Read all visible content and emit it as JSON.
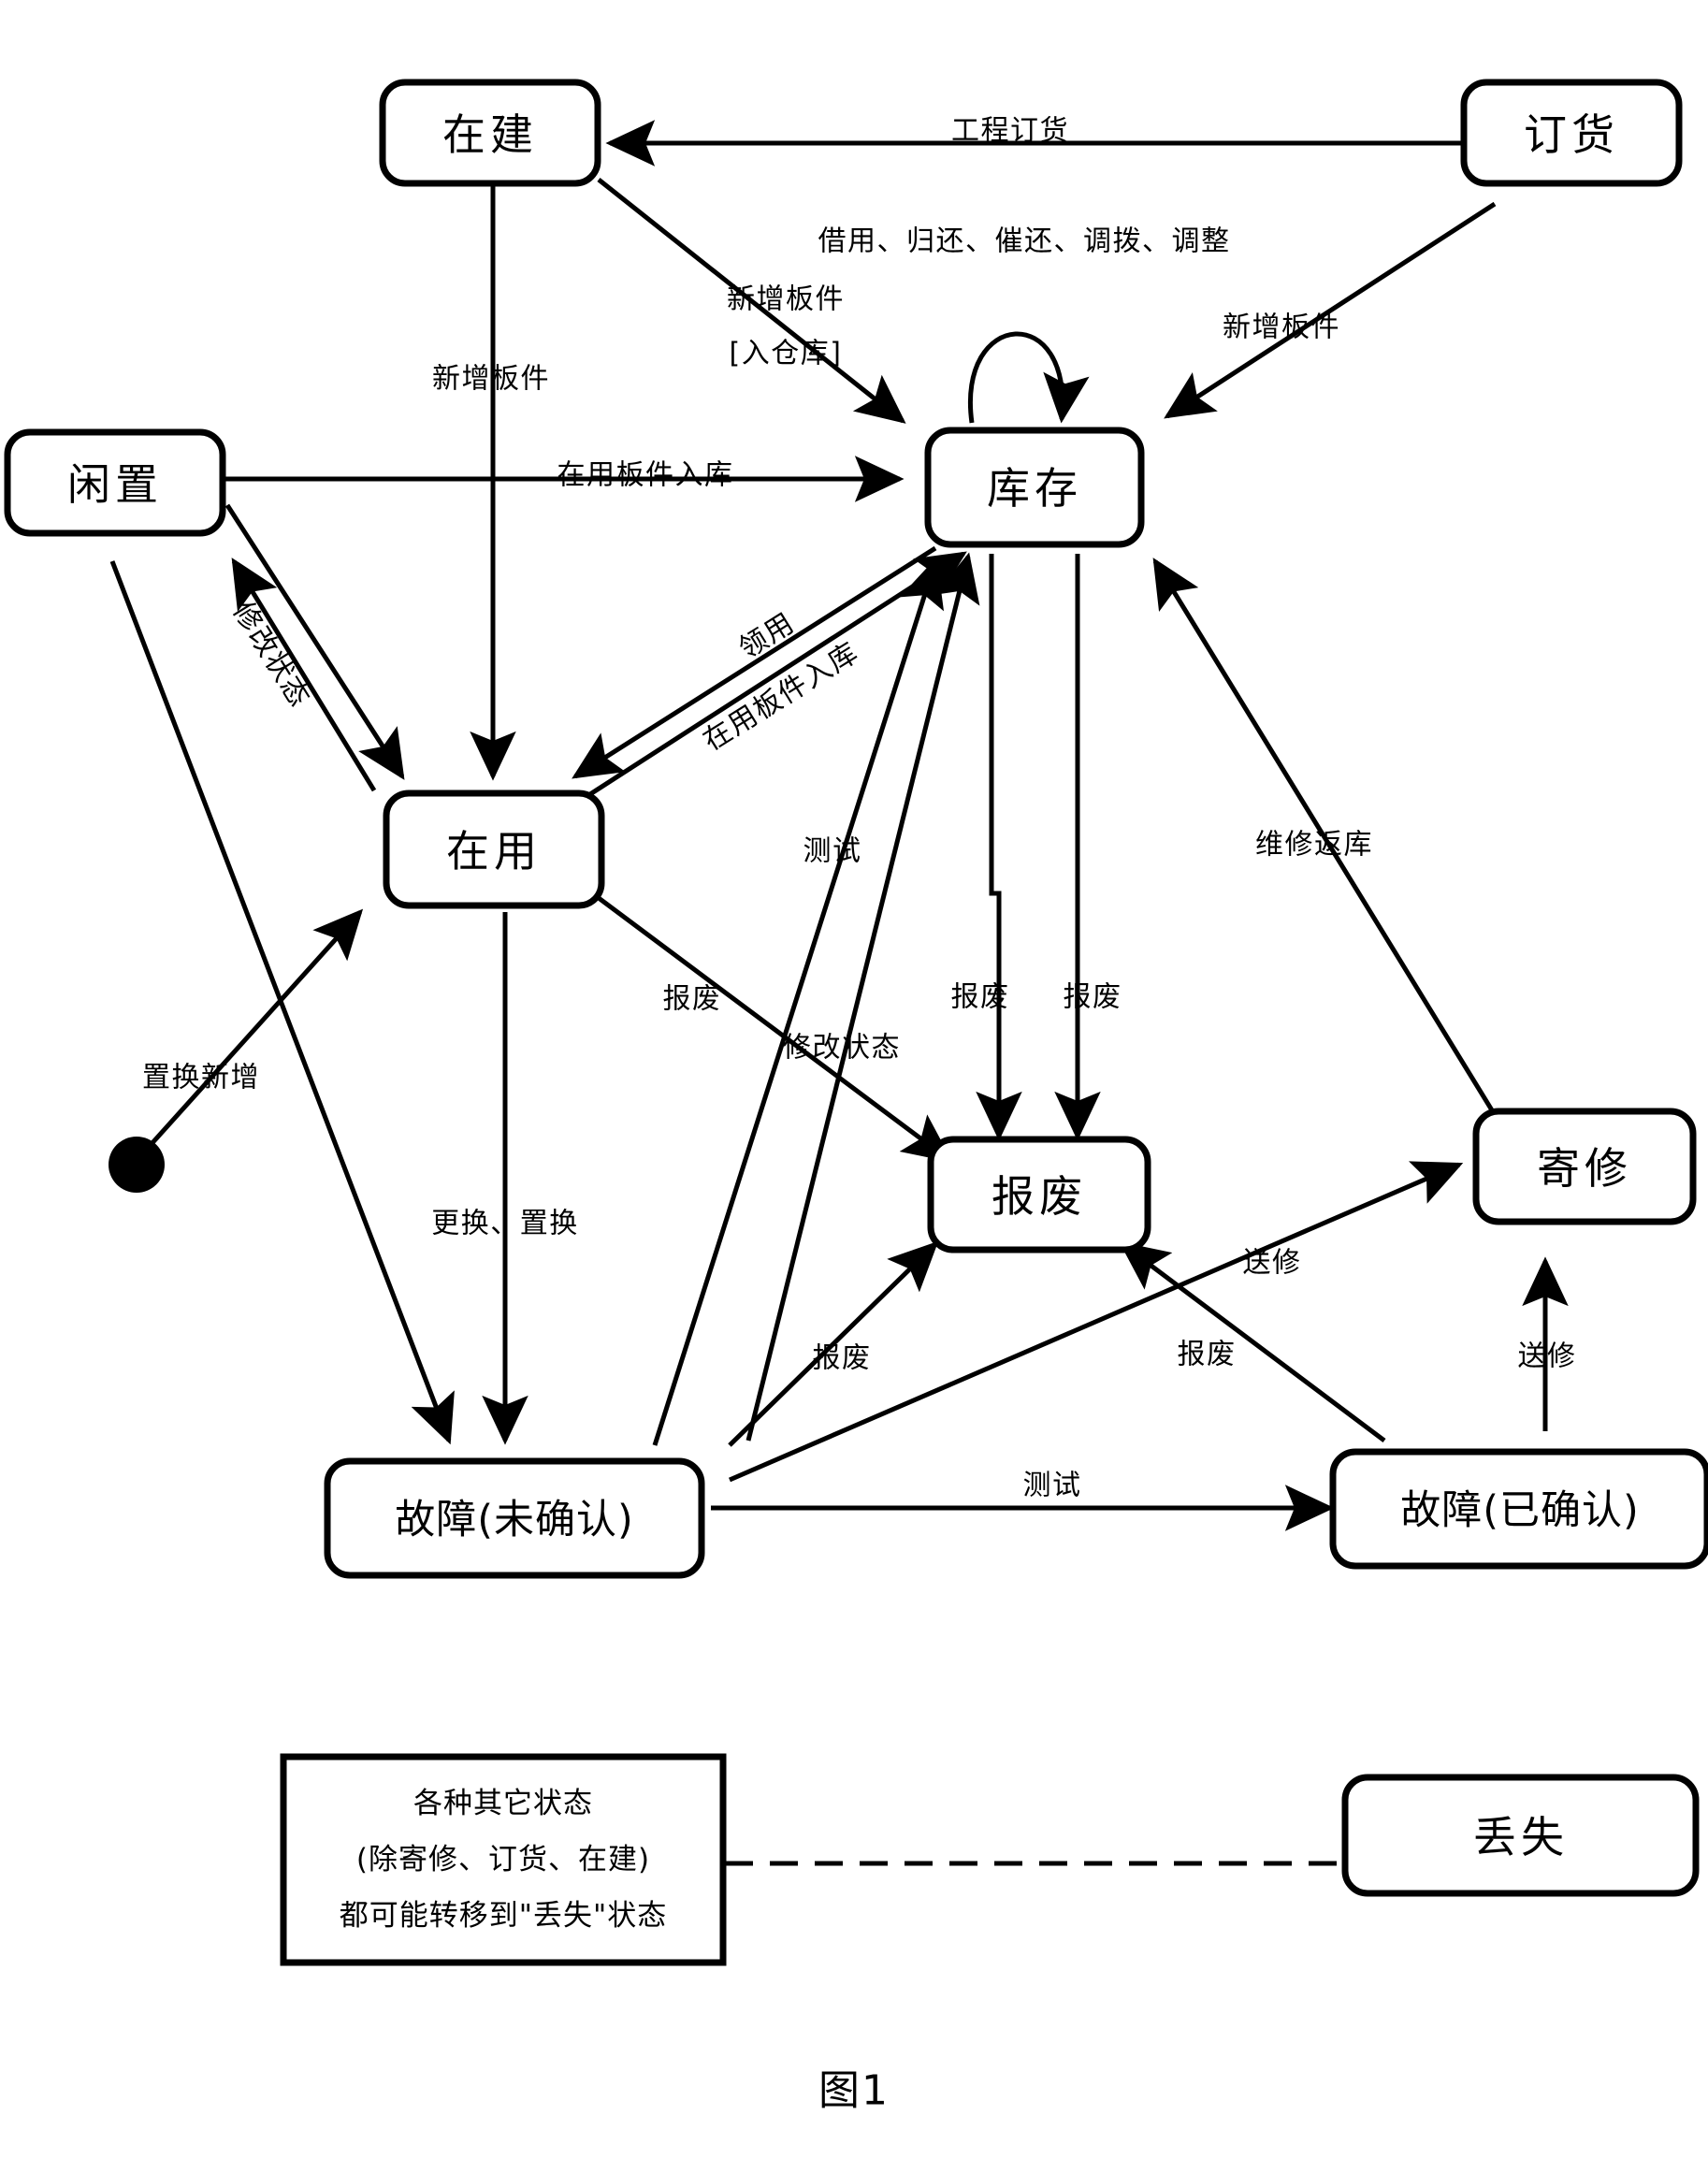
{
  "figure": {
    "caption": "图1"
  },
  "states": [
    {
      "id": "under_construction",
      "label": "在建"
    },
    {
      "id": "ordering",
      "label": "订货"
    },
    {
      "id": "idle",
      "label": "闲置"
    },
    {
      "id": "inventory",
      "label": "库存"
    },
    {
      "id": "in_use",
      "label": "在用"
    },
    {
      "id": "scrapped",
      "label": "报废"
    },
    {
      "id": "sent_repair",
      "label": "寄修"
    },
    {
      "id": "fault_unconfirmed",
      "label": "故障(未确认)"
    },
    {
      "id": "fault_confirmed",
      "label": "故障(已确认)"
    },
    {
      "id": "lost",
      "label": "丢失"
    }
  ],
  "transitions": [
    {
      "id": "t1",
      "label": "工程订货"
    },
    {
      "id": "t2",
      "label": "借用、归还、催还、调拨、调整"
    },
    {
      "id": "t3",
      "label": "新增板件"
    },
    {
      "id": "t4",
      "label": "新增板件"
    },
    {
      "id": "t5",
      "label": "[入仓库]"
    },
    {
      "id": "t6",
      "label": "新增板件"
    },
    {
      "id": "t7",
      "label": "在用板件入库"
    },
    {
      "id": "t8",
      "label": "领用"
    },
    {
      "id": "t9",
      "label": "在用板件入库"
    },
    {
      "id": "t10",
      "label": "修改状态"
    },
    {
      "id": "t11",
      "label": "置换新增"
    },
    {
      "id": "t12",
      "label": "更换、置换"
    },
    {
      "id": "t13",
      "label": "报废"
    },
    {
      "id": "t14",
      "label": "修改状态"
    },
    {
      "id": "t15",
      "label": "测试"
    },
    {
      "id": "t16",
      "label": "报废"
    },
    {
      "id": "t17",
      "label": "报废"
    },
    {
      "id": "t18",
      "label": "维修返库"
    },
    {
      "id": "t19",
      "label": "报废"
    },
    {
      "id": "t20",
      "label": "报废"
    },
    {
      "id": "t21",
      "label": "送修"
    },
    {
      "id": "t22",
      "label": "送修"
    },
    {
      "id": "t23",
      "label": "测试"
    }
  ],
  "note": {
    "lines": [
      "各种其它状态",
      "(除寄修、订货、在建)",
      "都可能转移到\"丢失\"状态"
    ]
  },
  "colors": {
    "stroke": "#000000",
    "fill": "#ffffff"
  }
}
